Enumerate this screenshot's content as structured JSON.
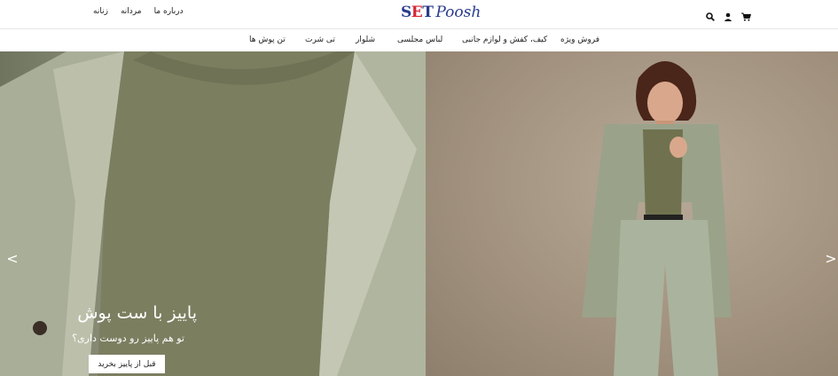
{
  "header": {
    "logo_part_a_1": "S",
    "logo_part_a_2": "E",
    "logo_part_a_3": "T",
    "logo_part_b": "Poosh",
    "links": [
      "درباره ما",
      "مردانه",
      "زنانه"
    ],
    "icons": [
      "search-icon",
      "user-icon",
      "cart-icon"
    ]
  },
  "nav": {
    "items": [
      "فروش ویژه",
      "کیف، کفش و لوازم جانبی",
      "لباس مجلسی",
      "شلوار",
      "تی شرت",
      "تن پوش ها"
    ]
  },
  "hero": {
    "title": "پاییز با ست پوش",
    "subtitle": "تو هم پاییز رو دوست داری؟",
    "button_label": "قبل از پاییز بخرید",
    "prev_arrow": "<",
    "next_arrow": ">"
  }
}
